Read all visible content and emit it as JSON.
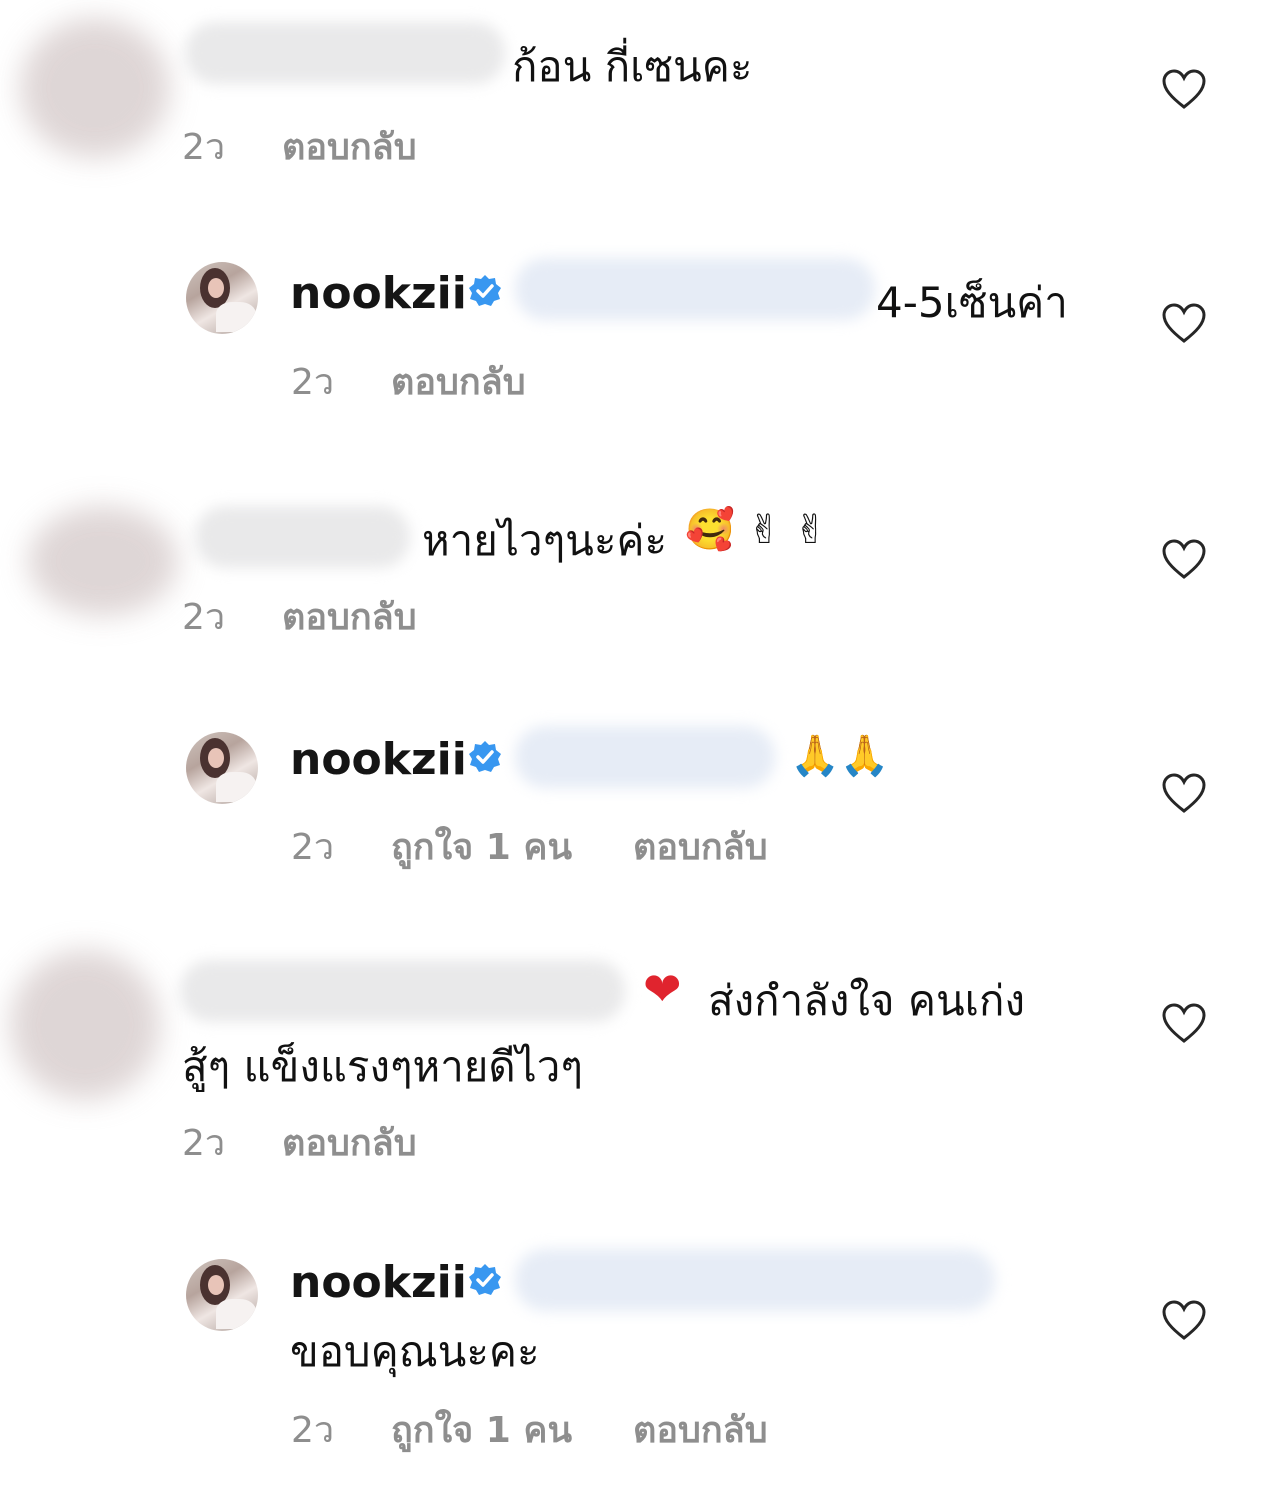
{
  "comments": [
    {
      "text": "ก้อน กี่เซนคะ",
      "time": "2ว",
      "reply": "ตอบกลับ"
    },
    {
      "username": "nookzii",
      "text": "4-5เซ็นค่า",
      "time": "2ว",
      "reply": "ตอบกลับ"
    },
    {
      "text": "หายไวๆนะค่ะ",
      "emoji": "🥰 ✌ ✌",
      "time": "2ว",
      "reply": "ตอบกลับ"
    },
    {
      "username": "nookzii",
      "emoji": "🙏🙏",
      "time": "2ว",
      "likes": "ถูกใจ 1 คน",
      "reply": "ตอบกลับ"
    },
    {
      "emoji": "❤",
      "text_line1": "ส่งกำลังใจ คนเก่ง",
      "text_line2": "สู้ๆ แข็งแรงๆหายดีไวๆ",
      "time": "2ว",
      "reply": "ตอบกลับ"
    },
    {
      "username": "nookzii",
      "text": "ขอบคุณนะคะ",
      "time": "2ว",
      "likes": "ถูกใจ 1 คน",
      "reply": "ตอบกลับ"
    }
  ],
  "colors": {
    "verified": "#3897f0",
    "meta_text": "#8e8e8e",
    "heart_stroke": "#262626"
  },
  "icons": {
    "heart": "heart-outline-icon",
    "verified": "verified-badge-icon"
  }
}
